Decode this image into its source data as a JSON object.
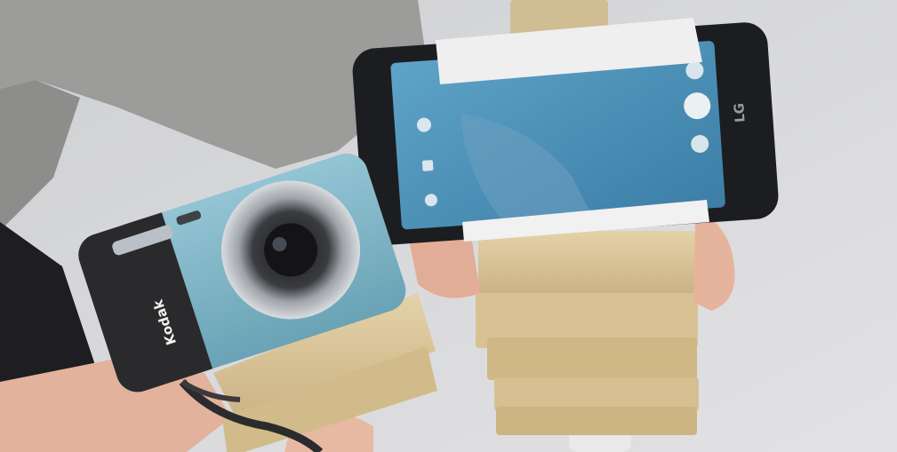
{
  "scene": {
    "description_free": true,
    "colors": {
      "background": "#d8d8da",
      "sweater": "#9a9a98",
      "camera_body": "#7fb3c4",
      "camera_grip": "#2a2a2c",
      "phone_body": "#1c1d20",
      "phone_screen": "#4b8fb7",
      "wood_blocks": "#d9c49a",
      "skin": "#e8b9a3"
    }
  },
  "camera": {
    "brand": "Kodak"
  },
  "phone": {
    "brand": "LG",
    "screen_icons": [
      "gear-icon",
      "mode-icon",
      "record-icon",
      "shutter-icon",
      "gallery-icon",
      "switch-camera-icon"
    ]
  }
}
